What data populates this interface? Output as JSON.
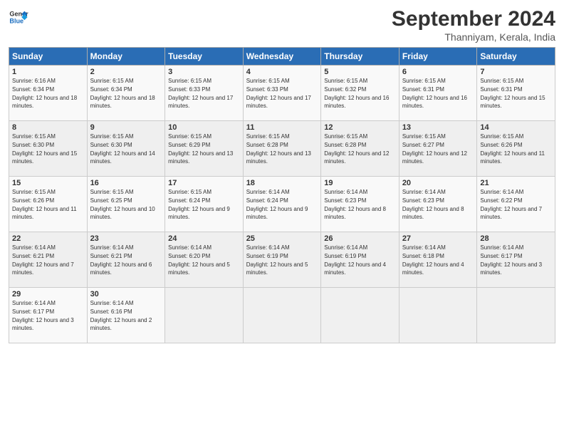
{
  "header": {
    "logo_line1": "General",
    "logo_line2": "Blue",
    "month_title": "September 2024",
    "subtitle": "Thanniyam, Kerala, India"
  },
  "weekdays": [
    "Sunday",
    "Monday",
    "Tuesday",
    "Wednesday",
    "Thursday",
    "Friday",
    "Saturday"
  ],
  "days": [
    {
      "day": "",
      "sunrise": "",
      "sunset": "",
      "daylight": ""
    },
    {
      "day": "",
      "sunrise": "",
      "sunset": "",
      "daylight": ""
    },
    {
      "day": "",
      "sunrise": "",
      "sunset": "",
      "daylight": ""
    },
    {
      "day": "",
      "sunrise": "",
      "sunset": "",
      "daylight": ""
    },
    {
      "day": "",
      "sunrise": "",
      "sunset": "",
      "daylight": ""
    },
    {
      "day": "",
      "sunrise": "",
      "sunset": "",
      "daylight": ""
    },
    {
      "day": "",
      "sunrise": "",
      "sunset": "",
      "daylight": ""
    },
    {
      "day": 1,
      "sunrise": "Sunrise: 6:16 AM",
      "sunset": "Sunset: 6:34 PM",
      "daylight": "Daylight: 12 hours and 18 minutes."
    },
    {
      "day": 2,
      "sunrise": "Sunrise: 6:15 AM",
      "sunset": "Sunset: 6:34 PM",
      "daylight": "Daylight: 12 hours and 18 minutes."
    },
    {
      "day": 3,
      "sunrise": "Sunrise: 6:15 AM",
      "sunset": "Sunset: 6:33 PM",
      "daylight": "Daylight: 12 hours and 17 minutes."
    },
    {
      "day": 4,
      "sunrise": "Sunrise: 6:15 AM",
      "sunset": "Sunset: 6:33 PM",
      "daylight": "Daylight: 12 hours and 17 minutes."
    },
    {
      "day": 5,
      "sunrise": "Sunrise: 6:15 AM",
      "sunset": "Sunset: 6:32 PM",
      "daylight": "Daylight: 12 hours and 16 minutes."
    },
    {
      "day": 6,
      "sunrise": "Sunrise: 6:15 AM",
      "sunset": "Sunset: 6:31 PM",
      "daylight": "Daylight: 12 hours and 16 minutes."
    },
    {
      "day": 7,
      "sunrise": "Sunrise: 6:15 AM",
      "sunset": "Sunset: 6:31 PM",
      "daylight": "Daylight: 12 hours and 15 minutes."
    },
    {
      "day": 8,
      "sunrise": "Sunrise: 6:15 AM",
      "sunset": "Sunset: 6:30 PM",
      "daylight": "Daylight: 12 hours and 15 minutes."
    },
    {
      "day": 9,
      "sunrise": "Sunrise: 6:15 AM",
      "sunset": "Sunset: 6:30 PM",
      "daylight": "Daylight: 12 hours and 14 minutes."
    },
    {
      "day": 10,
      "sunrise": "Sunrise: 6:15 AM",
      "sunset": "Sunset: 6:29 PM",
      "daylight": "Daylight: 12 hours and 13 minutes."
    },
    {
      "day": 11,
      "sunrise": "Sunrise: 6:15 AM",
      "sunset": "Sunset: 6:28 PM",
      "daylight": "Daylight: 12 hours and 13 minutes."
    },
    {
      "day": 12,
      "sunrise": "Sunrise: 6:15 AM",
      "sunset": "Sunset: 6:28 PM",
      "daylight": "Daylight: 12 hours and 12 minutes."
    },
    {
      "day": 13,
      "sunrise": "Sunrise: 6:15 AM",
      "sunset": "Sunset: 6:27 PM",
      "daylight": "Daylight: 12 hours and 12 minutes."
    },
    {
      "day": 14,
      "sunrise": "Sunrise: 6:15 AM",
      "sunset": "Sunset: 6:26 PM",
      "daylight": "Daylight: 12 hours and 11 minutes."
    },
    {
      "day": 15,
      "sunrise": "Sunrise: 6:15 AM",
      "sunset": "Sunset: 6:26 PM",
      "daylight": "Daylight: 12 hours and 11 minutes."
    },
    {
      "day": 16,
      "sunrise": "Sunrise: 6:15 AM",
      "sunset": "Sunset: 6:25 PM",
      "daylight": "Daylight: 12 hours and 10 minutes."
    },
    {
      "day": 17,
      "sunrise": "Sunrise: 6:15 AM",
      "sunset": "Sunset: 6:24 PM",
      "daylight": "Daylight: 12 hours and 9 minutes."
    },
    {
      "day": 18,
      "sunrise": "Sunrise: 6:14 AM",
      "sunset": "Sunset: 6:24 PM",
      "daylight": "Daylight: 12 hours and 9 minutes."
    },
    {
      "day": 19,
      "sunrise": "Sunrise: 6:14 AM",
      "sunset": "Sunset: 6:23 PM",
      "daylight": "Daylight: 12 hours and 8 minutes."
    },
    {
      "day": 20,
      "sunrise": "Sunrise: 6:14 AM",
      "sunset": "Sunset: 6:23 PM",
      "daylight": "Daylight: 12 hours and 8 minutes."
    },
    {
      "day": 21,
      "sunrise": "Sunrise: 6:14 AM",
      "sunset": "Sunset: 6:22 PM",
      "daylight": "Daylight: 12 hours and 7 minutes."
    },
    {
      "day": 22,
      "sunrise": "Sunrise: 6:14 AM",
      "sunset": "Sunset: 6:21 PM",
      "daylight": "Daylight: 12 hours and 7 minutes."
    },
    {
      "day": 23,
      "sunrise": "Sunrise: 6:14 AM",
      "sunset": "Sunset: 6:21 PM",
      "daylight": "Daylight: 12 hours and 6 minutes."
    },
    {
      "day": 24,
      "sunrise": "Sunrise: 6:14 AM",
      "sunset": "Sunset: 6:20 PM",
      "daylight": "Daylight: 12 hours and 5 minutes."
    },
    {
      "day": 25,
      "sunrise": "Sunrise: 6:14 AM",
      "sunset": "Sunset: 6:19 PM",
      "daylight": "Daylight: 12 hours and 5 minutes."
    },
    {
      "day": 26,
      "sunrise": "Sunrise: 6:14 AM",
      "sunset": "Sunset: 6:19 PM",
      "daylight": "Daylight: 12 hours and 4 minutes."
    },
    {
      "day": 27,
      "sunrise": "Sunrise: 6:14 AM",
      "sunset": "Sunset: 6:18 PM",
      "daylight": "Daylight: 12 hours and 4 minutes."
    },
    {
      "day": 28,
      "sunrise": "Sunrise: 6:14 AM",
      "sunset": "Sunset: 6:17 PM",
      "daylight": "Daylight: 12 hours and 3 minutes."
    },
    {
      "day": 29,
      "sunrise": "Sunrise: 6:14 AM",
      "sunset": "Sunset: 6:17 PM",
      "daylight": "Daylight: 12 hours and 3 minutes."
    },
    {
      "day": 30,
      "sunrise": "Sunrise: 6:14 AM",
      "sunset": "Sunset: 6:16 PM",
      "daylight": "Daylight: 12 hours and 2 minutes."
    }
  ]
}
